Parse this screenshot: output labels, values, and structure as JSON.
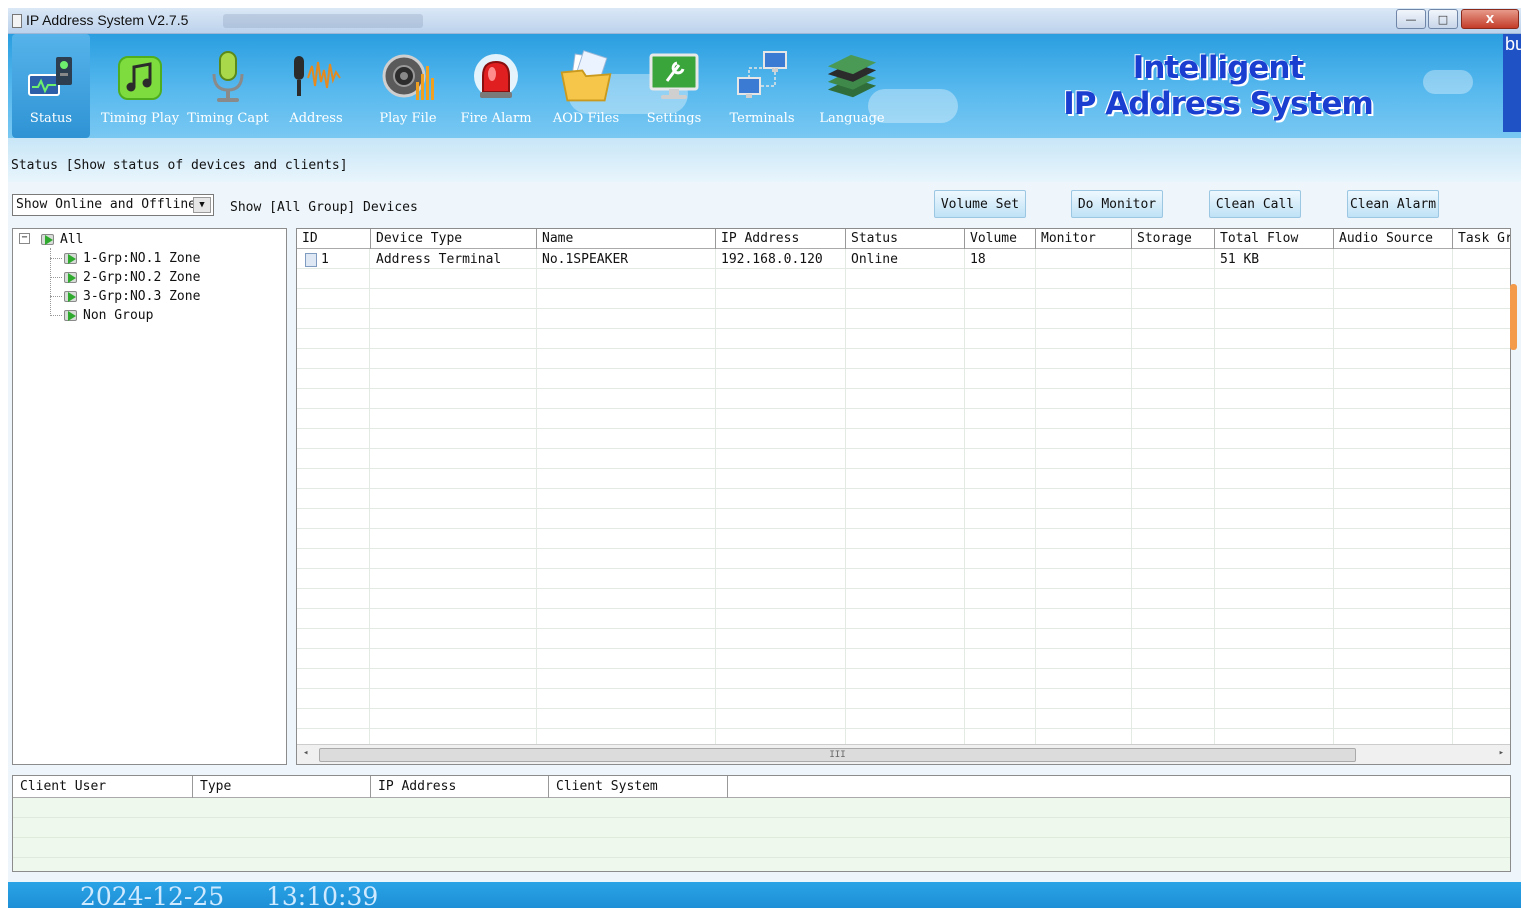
{
  "window": {
    "title": "IP Address System V2.7.5",
    "controls": {
      "minimize": "—",
      "maximize": "□",
      "close": "X"
    }
  },
  "toolbar": {
    "items": [
      {
        "label": "Status",
        "icon": "status-monitor-icon",
        "active": true
      },
      {
        "label": "Timing Play",
        "icon": "music-note-icon"
      },
      {
        "label": "Timing Capt",
        "icon": "microphone-icon"
      },
      {
        "label": "Address",
        "icon": "mic-waveform-icon"
      },
      {
        "label": "Play File",
        "icon": "speaker-icon"
      },
      {
        "label": "Fire Alarm",
        "icon": "alarm-light-icon"
      },
      {
        "label": "AOD Files",
        "icon": "folder-icon"
      },
      {
        "label": "Settings",
        "icon": "settings-screen-icon"
      },
      {
        "label": "Terminals",
        "icon": "network-terminals-icon"
      },
      {
        "label": "Language",
        "icon": "books-icon"
      }
    ],
    "brand_line1": "Intelligent",
    "brand_line2": "IP Address System",
    "edge_text": "bu"
  },
  "status_header": {
    "text": "Status  [Show status of devices and clients]"
  },
  "filter": {
    "selected": "Show Online and Offline",
    "caption": "Show [All Group] Devices"
  },
  "actions": {
    "volume_set": "Volume Set",
    "do_monitor": "Do Monitor",
    "clean_call": "Clean Call",
    "clean_alarm": "Clean Alarm"
  },
  "tree": {
    "root": "All",
    "children": [
      "1-Grp:NO.1 Zone",
      "2-Grp:NO.2 Zone",
      "3-Grp:NO.3 Zone",
      "Non Group"
    ],
    "expander": "−"
  },
  "grid": {
    "columns": [
      "ID",
      "Device Type",
      "Name",
      "IP Address",
      "Status",
      "Volume",
      "Monitor",
      "Storage",
      "Total Flow",
      "Audio Source",
      "Task Gr"
    ],
    "rows": [
      [
        "1",
        "Address Terminal",
        "No.1SPEAKER",
        "192.168.0.120",
        "Online",
        "18",
        "",
        "",
        "51 KB",
        "",
        ""
      ]
    ],
    "scroll_grip": "III",
    "scroll_left": "◂",
    "scroll_right": "▸"
  },
  "clients": {
    "columns": [
      "Client User",
      "Type",
      "IP Address",
      "Client System"
    ]
  },
  "footer": {
    "date": "2024-12-25",
    "time": "13:10:39"
  },
  "colors": {
    "toolbar_blue": "#2a9ee0",
    "brand_blue": "#1a3ed0",
    "footer_blue": "#1e8fd6",
    "scroll_accent": "#f39a4b"
  }
}
